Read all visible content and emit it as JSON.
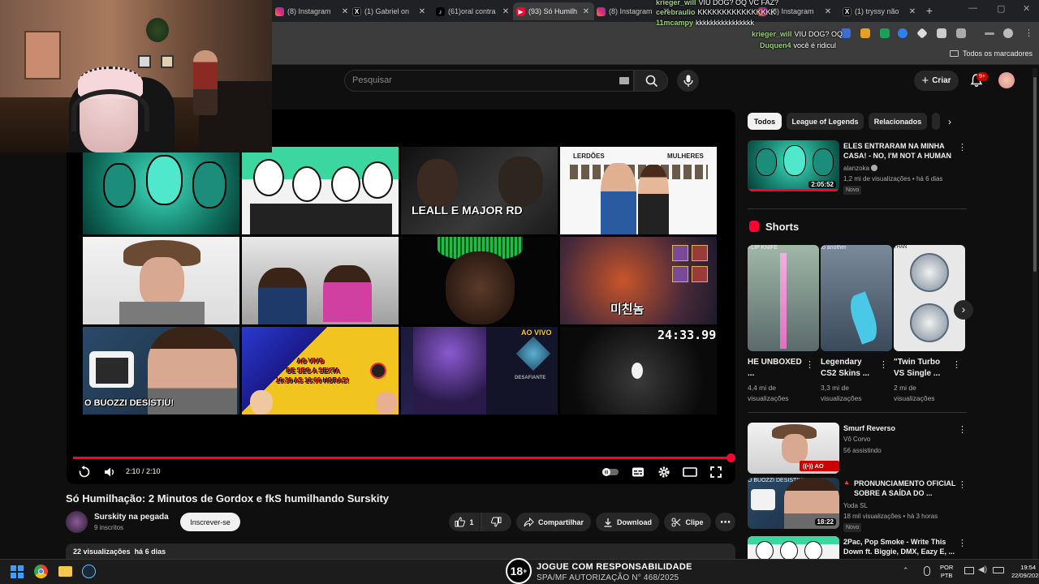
{
  "browser": {
    "tabs": [
      {
        "label": "(8) Instagram",
        "icon": "instagram-icon"
      },
      {
        "label": "(1) Gabriel on",
        "icon": "x-icon"
      },
      {
        "label": "(61)oral contra",
        "icon": "tiktok-icon"
      },
      {
        "label": "(93) Só Humilh",
        "icon": "youtube-icon",
        "active": true
      },
      {
        "label": "(8) Instagram",
        "icon": "instagram-icon"
      },
      {
        "label": "(8) Instagram",
        "icon": "instagram-icon"
      },
      {
        "label": "(1) tryssy não",
        "icon": "x-icon"
      }
    ],
    "bookmarks_all": "Todos os marcadores"
  },
  "chat": [
    {
      "name": "krieger_will",
      "text": "VIU DOG? OQ VC FAZ?"
    },
    {
      "name": "cerebraulio",
      "text": "KKKKKKKKKKKKKKKK"
    },
    {
      "name": "11mcampy",
      "text": "kkkkkkkkkkkkkkkk"
    },
    {
      "name": "krieger_will",
      "text": "VIU DOG? OQ"
    },
    {
      "name": "Duquen4",
      "text": "você é ridicul"
    }
  ],
  "youtube": {
    "search_placeholder": "Pesquisar",
    "create_label": "Criar",
    "notif_count": "9+"
  },
  "player": {
    "time": "2:10 / 2:10",
    "progress": 1.0,
    "thumb_texts": {
      "t4": "LEALL E MAJOR RD",
      "t5_left": "LERDÕES",
      "t5_right": "MULHERES",
      "t9": "미친놈",
      "t10": "O BUOZZI DESISTIU!",
      "t11_a": "AO VIVO",
      "t11_b": "DE SEG A SEXTA",
      "t11_c": "10:30 AS 16:00 HORAS!",
      "t12": "AO VIVO",
      "t12_sub": "DESAFIANTE"
    },
    "timer": "24:33.99"
  },
  "video": {
    "title": "Só Humilhação: 2 Minutos de Gordox e fkS humilhando Surskity",
    "channel": "Surskity na pegada",
    "subscribers": "9 inscritos",
    "subscribe_label": "Inscrever-se",
    "likes": "1",
    "share_label": "Compartilhar",
    "download_label": "Download",
    "clip_label": "Clipe",
    "views": "22 visualizações",
    "date": "há 6 dias"
  },
  "sidebar": {
    "chips": [
      "Todos",
      "League of Legends",
      "Relacionados"
    ],
    "shorts_label": "Shorts",
    "videos": [
      {
        "title": "ELES ENTRARAM NA MINHA CASA! - NO, I'M NOT A HUMAN",
        "channel": "alanzoka",
        "meta": "1,2 mi de visualizações • há 6 dias",
        "badge": "Novo",
        "duration": "2:05:52"
      },
      {
        "title": "Smurf Reverso",
        "channel": "Vô Corvo",
        "meta": "56 assistindo",
        "live": "AO VIVO"
      },
      {
        "title": "PRONUNCIAMENTO OFICIAL SOBRE A SAÍDA DO ...",
        "channel": "Yoda SL",
        "meta": "18 mil visualizações • há 3 horas",
        "badge": "Novo",
        "duration": "18:22",
        "thumb_text": "O BUOZZI DESISTIU!"
      },
      {
        "title": "2Pac, Pop Smoke - Write This Down ft. Biggie, DMX, Eazy E, ...",
        "channel": "",
        "meta": ""
      }
    ],
    "shorts": [
      {
        "title": "HE UNBOXED ...",
        "views": "4,4 mi de visualizações",
        "thumb_text": "FLIP KNIFE"
      },
      {
        "title": "Legendary CS2 Skins ...",
        "views": "3,3 mi de visualizações",
        "thumb_text": "to another"
      },
      {
        "title": "\"Twin Turbo VS Single ...",
        "views": "2 mi de visualizações",
        "thumb_text": "THAN"
      }
    ]
  },
  "taskbar": {
    "age_label": "18",
    "responsible_1": "JOGUE COM RESPONSABILIDADE",
    "responsible_2": "SPA/MF AUTORIZAÇÃO N° 468/2025",
    "lang_1": "POR",
    "lang_2": "PTB",
    "time": "19:54",
    "date": "22/09/2025"
  }
}
